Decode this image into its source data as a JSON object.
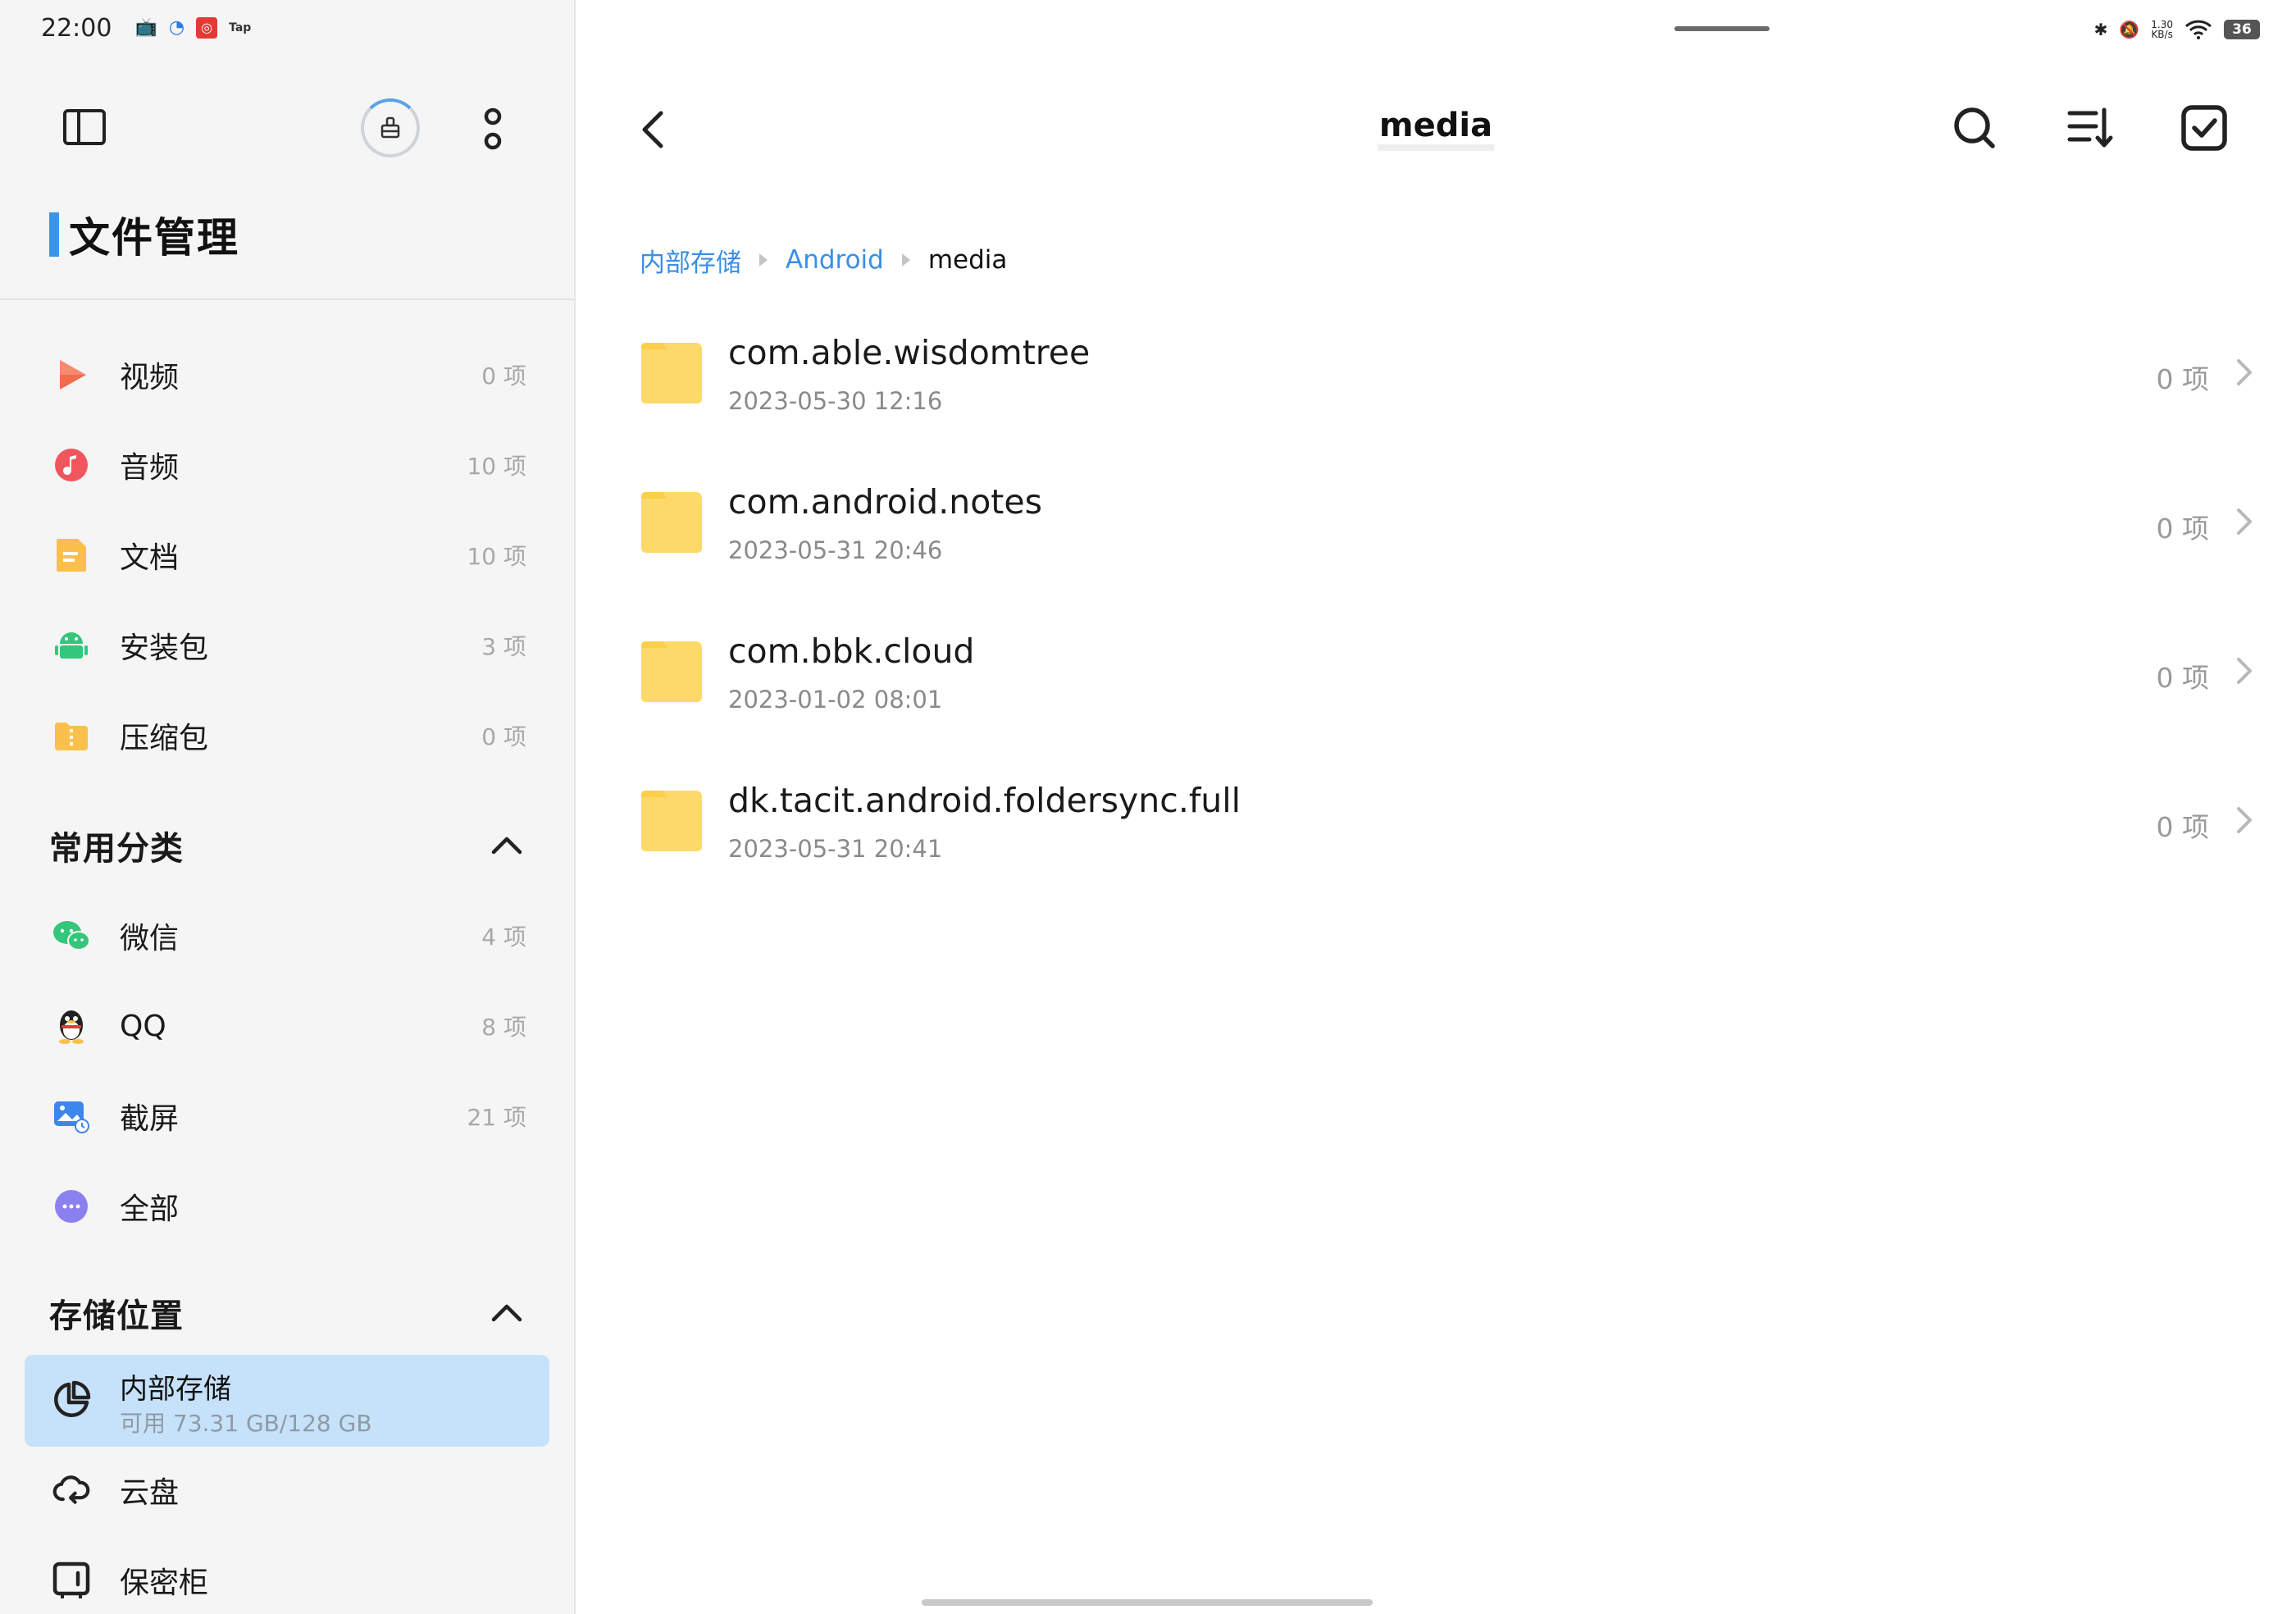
{
  "status": {
    "time": "22:00",
    "tap_label": "Tap",
    "speed_value": "1.30",
    "speed_unit": "KB/s",
    "battery": "36"
  },
  "sidebar": {
    "title": "文件管理",
    "categories": [
      {
        "label": "视频",
        "count": "0 项",
        "icon": "video-icon"
      },
      {
        "label": "音频",
        "count": "10 项",
        "icon": "audio-icon"
      },
      {
        "label": "文档",
        "count": "10 项",
        "icon": "document-icon"
      },
      {
        "label": "安装包",
        "count": "3 项",
        "icon": "android-package-icon"
      },
      {
        "label": "压缩包",
        "count": "0 项",
        "icon": "archive-icon"
      }
    ],
    "common_section": "常用分类",
    "common": [
      {
        "label": "微信",
        "count": "4 项",
        "icon": "wechat-icon"
      },
      {
        "label": "QQ",
        "count": "8 项",
        "icon": "qq-icon"
      },
      {
        "label": "截屏",
        "count": "21 项",
        "icon": "screenshot-icon"
      },
      {
        "label": "全部",
        "count": "",
        "icon": "more-dots-icon"
      }
    ],
    "storage_section": "存储位置",
    "storage": {
      "internal_label": "内部存储",
      "internal_sub": "可用 73.31 GB/128 GB",
      "cloud_label": "云盘",
      "safe_label": "保密柜"
    }
  },
  "main": {
    "title": "media",
    "breadcrumb": [
      "内部存储",
      "Android",
      "media"
    ],
    "files": [
      {
        "name": "com.able.wisdomtree",
        "date": "2023-05-30 12:16",
        "count": "0 项"
      },
      {
        "name": "com.android.notes",
        "date": "2023-05-31 20:46",
        "count": "0 项"
      },
      {
        "name": "com.bbk.cloud",
        "date": "2023-01-02 08:01",
        "count": "0 项"
      },
      {
        "name": "dk.tacit.android.foldersync.full",
        "date": "2023-05-31 20:41",
        "count": "0 项"
      }
    ]
  },
  "colors": {
    "accent": "#3a8ee6",
    "folder": "#fdd96a",
    "active_bg": "#c6e2fb"
  }
}
